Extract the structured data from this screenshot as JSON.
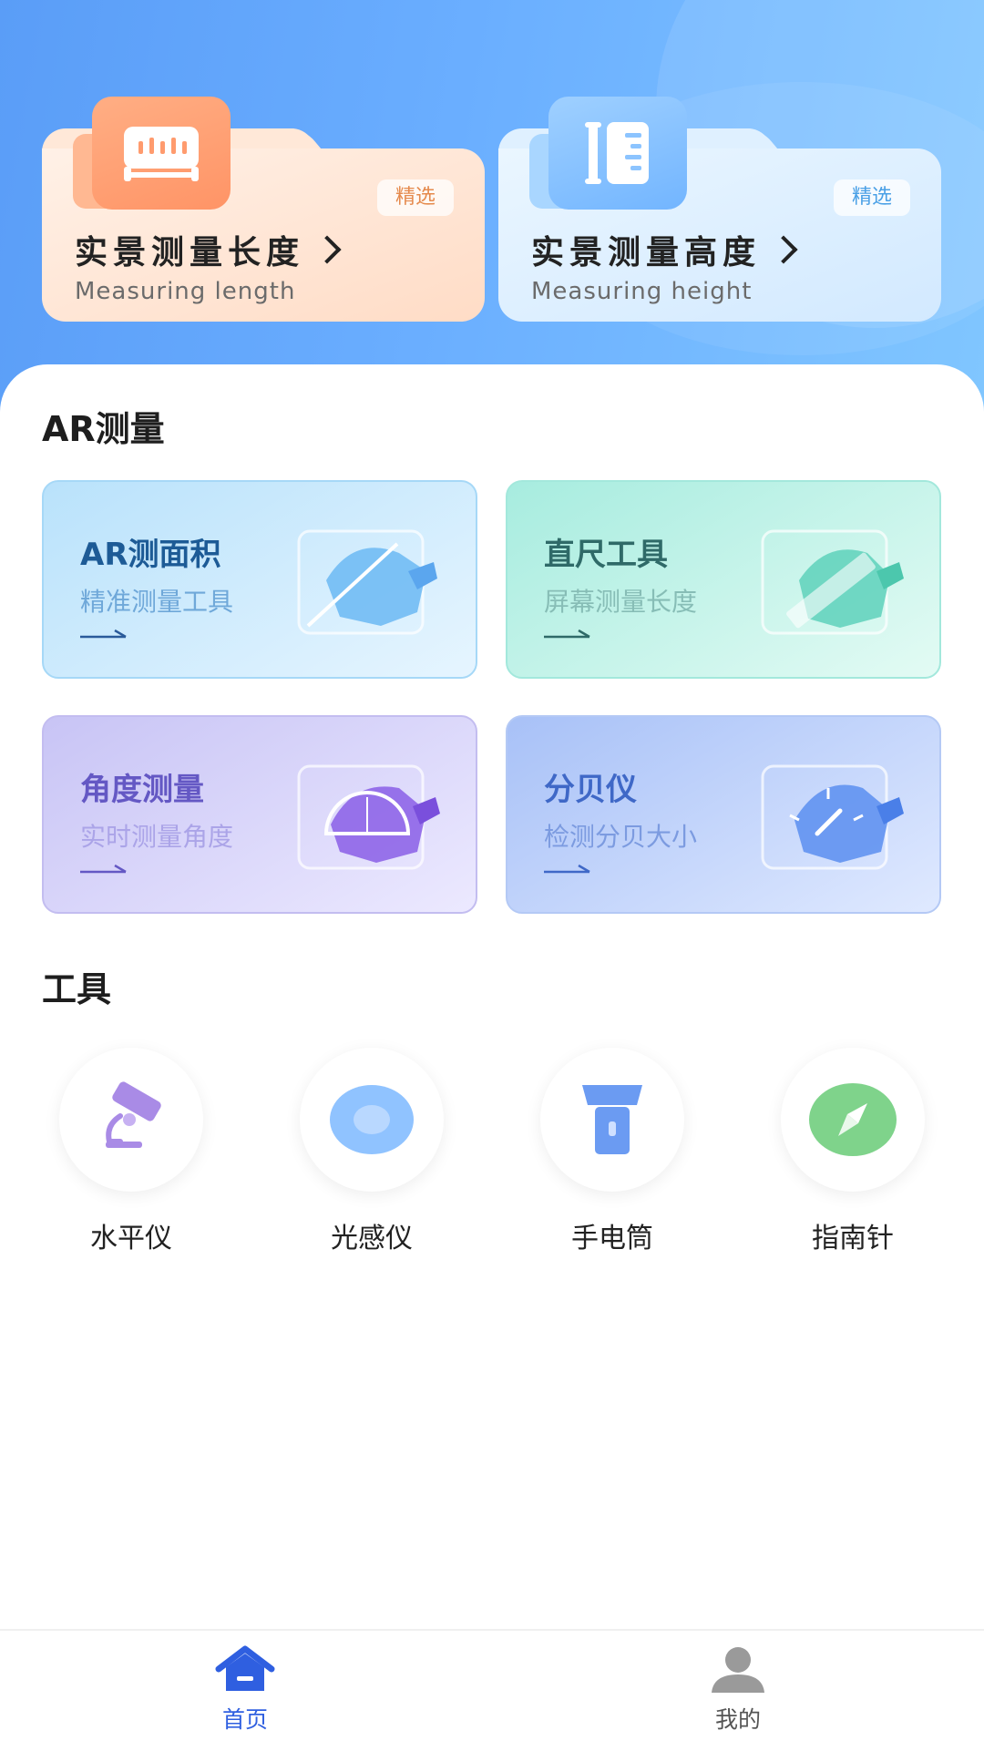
{
  "featured": [
    {
      "title": "实景测量长度",
      "subtitle": "Measuring length",
      "badge": "精选",
      "icon": "measuring-tape-icon"
    },
    {
      "title": "实景测量高度",
      "subtitle": "Measuring height",
      "badge": "精选",
      "icon": "height-ruler-icon"
    }
  ],
  "sections": {
    "ar_title": "AR测量",
    "tools_title": "工具"
  },
  "ar_cards": [
    {
      "name": "AR测面积",
      "desc": "精准测量工具",
      "icon": "area-measure-icon"
    },
    {
      "name": "直尺工具",
      "desc": "屏幕测量长度",
      "icon": "ruler-icon"
    },
    {
      "name": "角度测量",
      "desc": "实时测量角度",
      "icon": "protractor-icon"
    },
    {
      "name": "分贝仪",
      "desc": "检测分贝大小",
      "icon": "decibel-meter-icon"
    }
  ],
  "tools": [
    {
      "label": "水平仪",
      "icon": "level-icon",
      "color": "#a98be6"
    },
    {
      "label": "光感仪",
      "icon": "light-sensor-icon",
      "color": "#90c3ff"
    },
    {
      "label": "手电筒",
      "icon": "flashlight-icon",
      "color": "#6b9bf2"
    },
    {
      "label": "指南针",
      "icon": "compass-icon",
      "color": "#7fd38b"
    }
  ],
  "nav": [
    {
      "label": "首页",
      "icon": "home-icon",
      "active": true,
      "color": "#2f5fe0"
    },
    {
      "label": "我的",
      "icon": "user-icon",
      "active": false,
      "color": "#9a9a9a"
    }
  ]
}
